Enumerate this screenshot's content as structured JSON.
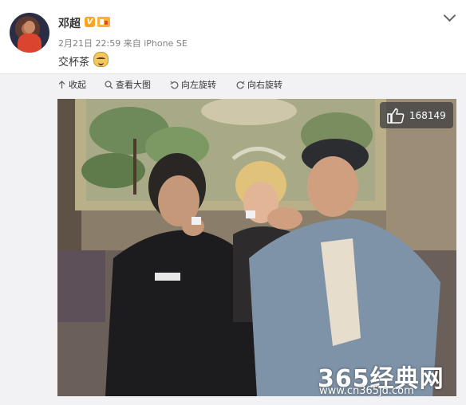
{
  "post": {
    "username": "邓超",
    "date": "2月21日 22:59",
    "source_prefix": "来自",
    "source": "iPhone SE",
    "text": "交杯茶",
    "emoji": "doge-emoji",
    "v_badge": "V"
  },
  "toolbar": {
    "collapse": "收起",
    "view_large": "查看大图",
    "rotate_left": "向左旋转",
    "rotate_right": "向右旋转"
  },
  "photo": {
    "like_count": "168149",
    "watermark_title": "365经典网",
    "watermark_url": "www.cn365jd.com"
  },
  "colors": {
    "accent_gold": "#f6a623",
    "panel_bg": "#f2f2f5",
    "text_main": "#333333",
    "text_meta": "#808080"
  },
  "icons": [
    "chevron-down-icon",
    "collapse-icon",
    "search-icon",
    "rotate-left-icon",
    "rotate-right-icon",
    "thumbs-up-icon"
  ]
}
